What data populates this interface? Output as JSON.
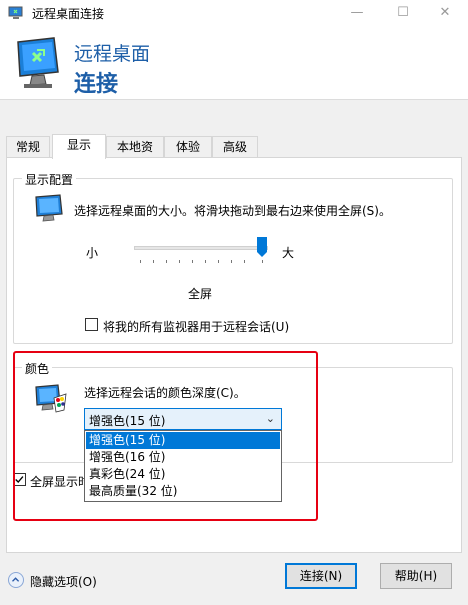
{
  "window": {
    "title": "远程桌面连接",
    "minimize": "—",
    "maximize": "☐",
    "close": "✕"
  },
  "header": {
    "line1": "远程桌面",
    "line2": "连接"
  },
  "tabs": [
    "常规",
    "显示",
    "本地资源",
    "体验",
    "高级"
  ],
  "display_config": {
    "group_label": "显示配置",
    "description": "选择远程桌面的大小。将滑块拖动到最右边来使用全屏(S)。",
    "slider_min_label": "小",
    "slider_max_label": "大",
    "slider_value_label": "全屏",
    "slider_position": 1.0,
    "multi_monitor_label": "将我的所有监视器用于远程会话(U)",
    "multi_monitor_checked": false
  },
  "colors": {
    "group_label": "颜色",
    "description": "选择远程会话的颜色深度(C)。",
    "selected": "增强色(15 位)",
    "options": [
      "增强色(15 位)",
      "增强色(16 位)",
      "真彩色(24 位)",
      "最高质量(32 位)"
    ]
  },
  "fullscreen_bar": {
    "label": "全屏显示时",
    "checked": true
  },
  "footer": {
    "hide_options": "隐藏选项(O)",
    "connect": "连接(N)",
    "help": "帮助(H)"
  },
  "accent_colors": {
    "title_blue": "#1e5fa8",
    "selection_blue": "#0078d7",
    "highlight_red": "#e60012"
  }
}
